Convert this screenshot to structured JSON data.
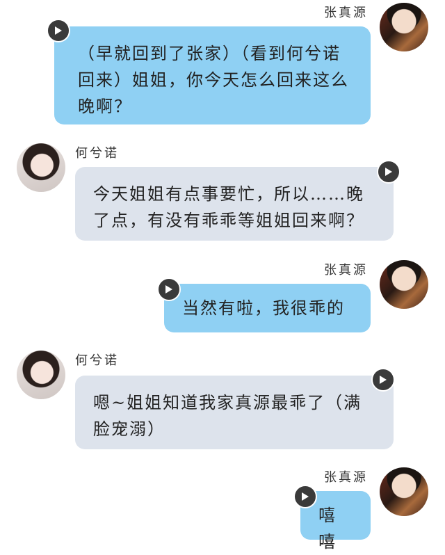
{
  "messages": [
    {
      "speaker": "张真源",
      "side": "right",
      "avatar": "boy-avatar",
      "text": "（早就回到了张家）（看到何兮诺回来）姐姐，你今天怎么回来这么晚啊？"
    },
    {
      "speaker": "何兮诺",
      "side": "left",
      "avatar": "girl-avatar",
      "text": "今天姐姐有点事要忙，所以……晚了点，有没有乖乖等姐姐回来啊？"
    },
    {
      "speaker": "张真源",
      "side": "right",
      "avatar": "boy-avatar",
      "text": "当然有啦，我很乖的"
    },
    {
      "speaker": "何兮诺",
      "side": "left",
      "avatar": "girl-avatar",
      "text": "嗯~姐姐知道我家真源最乖了（满脸宠溺）"
    },
    {
      "speaker": "张真源",
      "side": "right",
      "avatar": "boy-avatar",
      "text": "嘻嘻"
    }
  ],
  "colors": {
    "right_bubble": "#8fd0f3",
    "left_bubble": "#dde3ec",
    "play_button": "#3a3a3a"
  },
  "icons": {
    "play": "play-icon"
  }
}
